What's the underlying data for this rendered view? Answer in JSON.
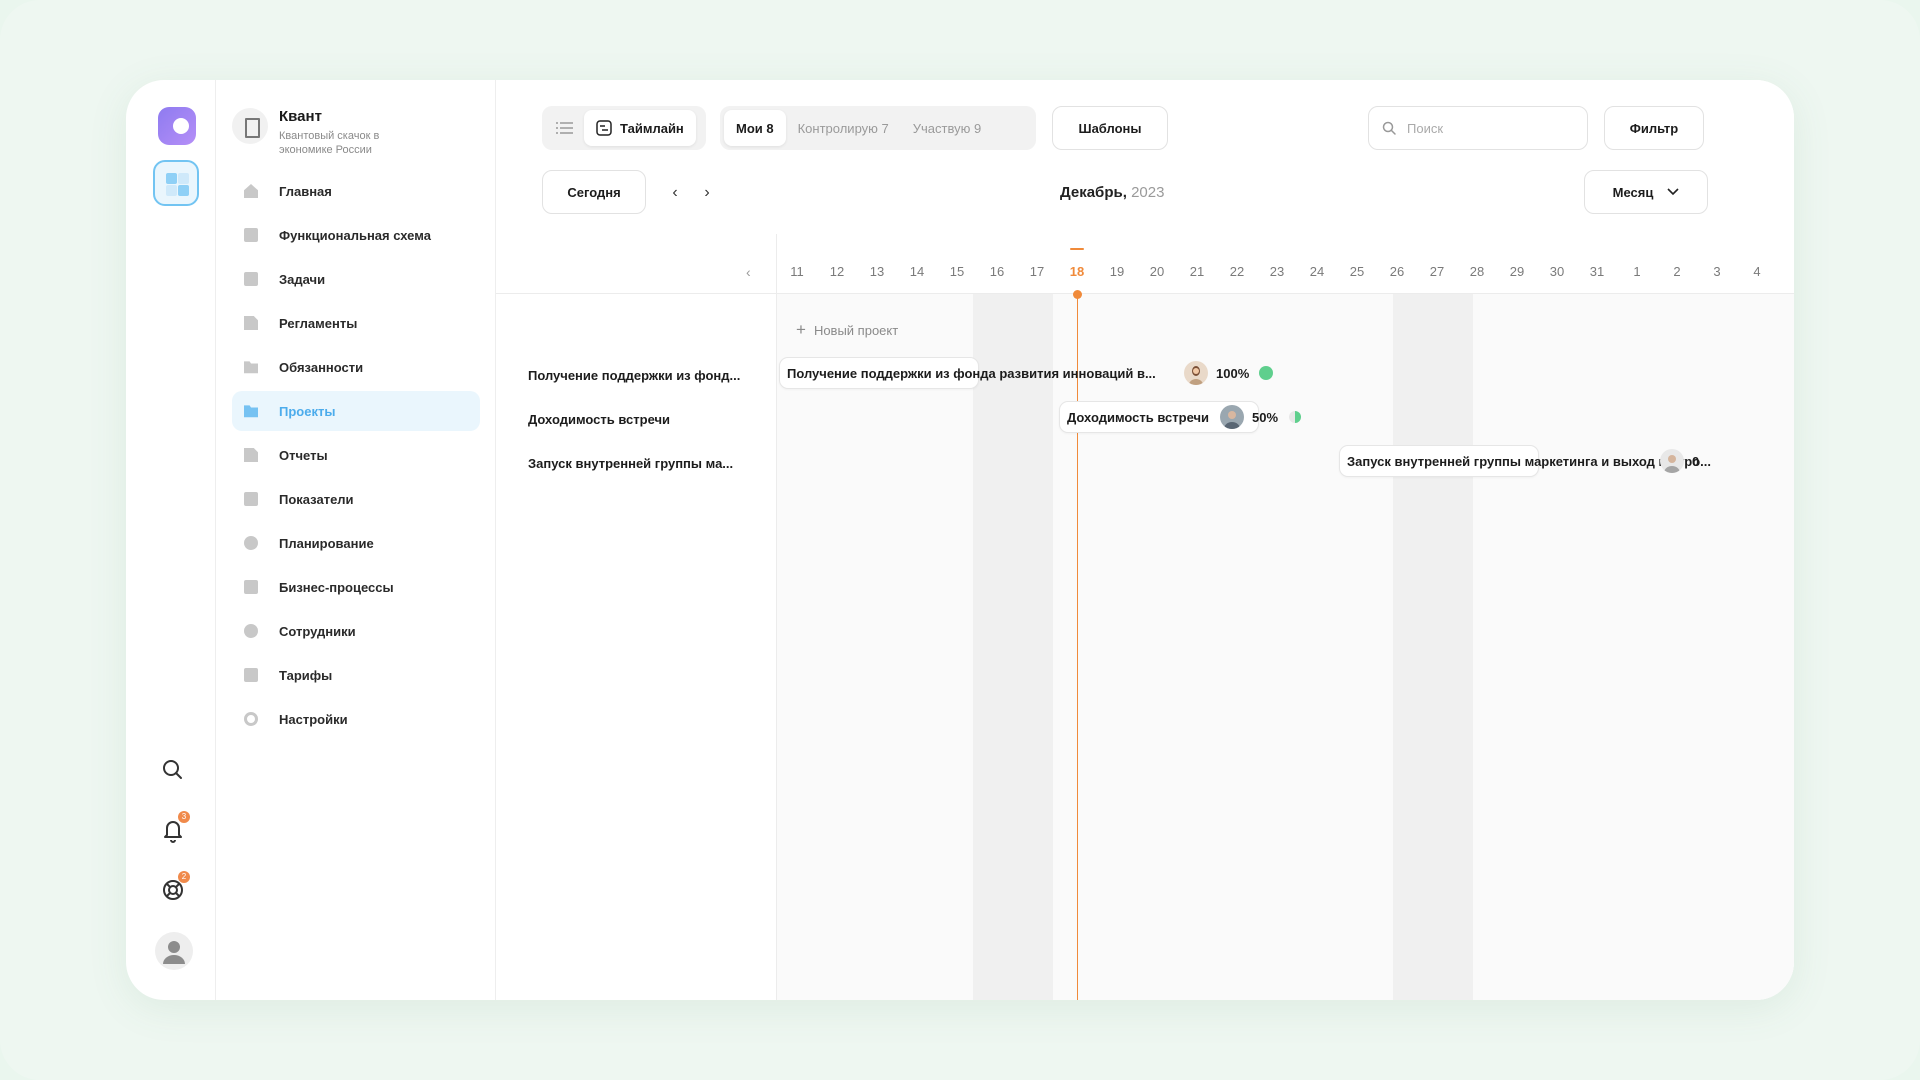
{
  "org": {
    "name": "Квант",
    "description": "Квантовый скачок в экономике России"
  },
  "rail": {
    "notifications_badge": "3",
    "support_badge": "2"
  },
  "sidebar": {
    "items": [
      {
        "label": "Главная",
        "icon": "home-icon"
      },
      {
        "label": "Функциональная схема",
        "icon": "schema-icon"
      },
      {
        "label": "Задачи",
        "icon": "tasks-icon"
      },
      {
        "label": "Регламенты",
        "icon": "document-icon"
      },
      {
        "label": "Обязанности",
        "icon": "folder-icon"
      },
      {
        "label": "Проекты",
        "icon": "projects-icon",
        "active": true
      },
      {
        "label": "Отчеты",
        "icon": "report-icon"
      },
      {
        "label": "Показатели",
        "icon": "chart-icon"
      },
      {
        "label": "Планирование",
        "icon": "clock-icon"
      },
      {
        "label": "Бизнес-процессы",
        "icon": "briefcase-icon"
      },
      {
        "label": "Сотрудники",
        "icon": "people-icon"
      },
      {
        "label": "Тарифы",
        "icon": "card-icon"
      },
      {
        "label": "Настройки",
        "icon": "gear-icon"
      }
    ]
  },
  "toolbar": {
    "view_timeline": "Таймлайн",
    "filter_mine": "Мои 8",
    "filter_control": "Контролирую 7",
    "filter_participate": "Участвую 9",
    "templates": "Шаблоны",
    "search_placeholder": "Поиск",
    "filter_button": "Фильтр",
    "today_button": "Сегодня",
    "period_select": "Месяц"
  },
  "calendar": {
    "month": "Декабрь,",
    "year": "2023",
    "days": [
      "11",
      "12",
      "13",
      "14",
      "15",
      "16",
      "17",
      "18",
      "19",
      "20",
      "21",
      "22",
      "23",
      "24",
      "25",
      "26",
      "27",
      "28",
      "29",
      "30",
      "31",
      "1",
      "2",
      "3",
      "4"
    ],
    "today": "18"
  },
  "timeline": {
    "new_project": "Новый проект",
    "rows": [
      {
        "label": "Получение поддержки из фонд...",
        "bar_title": "Получение поддержки из фонда развития инноваций в...",
        "progress": "100%",
        "status_color": "#5fcf8d"
      },
      {
        "label": "Доходимость встречи",
        "bar_title": "Доходимость встречи",
        "progress": "50%",
        "status_color": "#5fcf8d"
      },
      {
        "label": "Запуск внутренней группы ма...",
        "bar_title": "Запуск внутренней группы маркетинга и выход на уро...",
        "progress": "0"
      }
    ]
  },
  "colors": {
    "accent": "#4cacec",
    "today": "#f08a3a",
    "status_done": "#5fcf8d"
  }
}
